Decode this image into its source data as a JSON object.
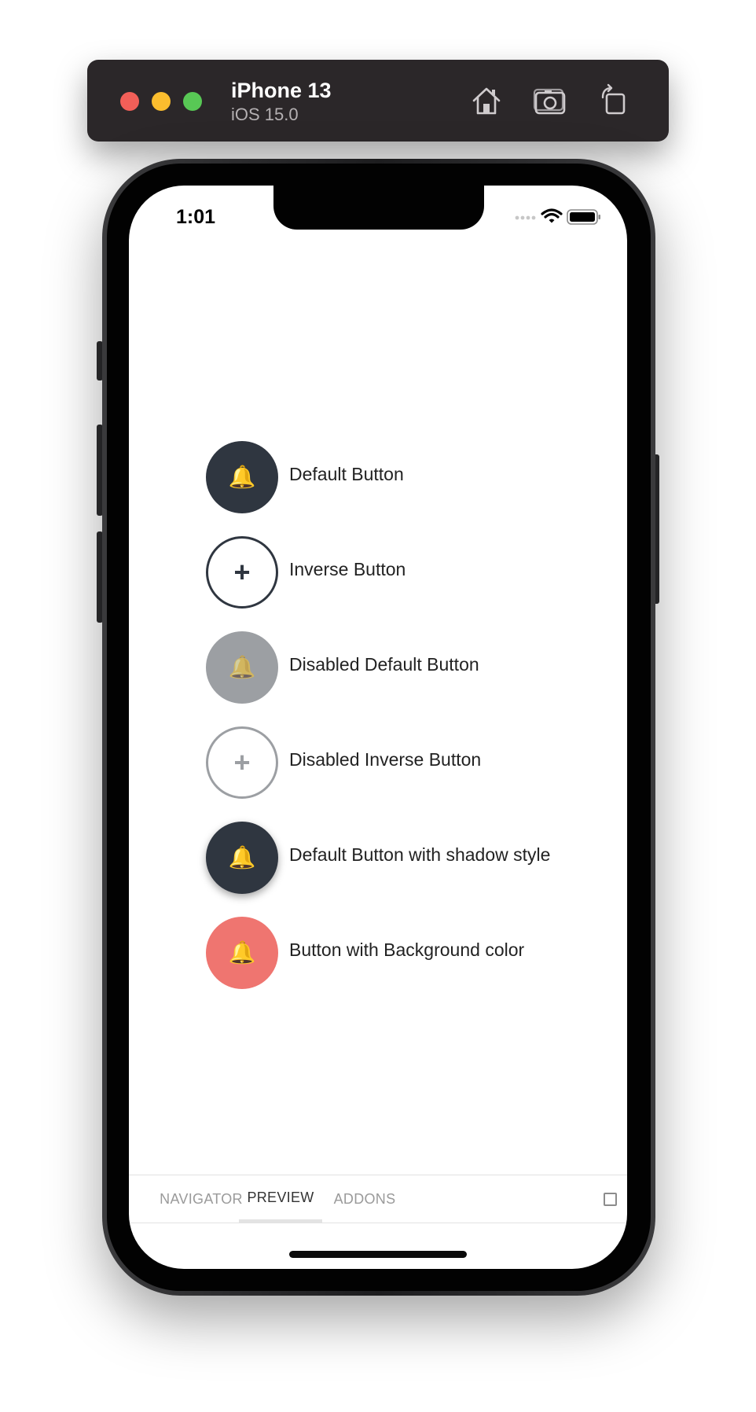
{
  "simulator": {
    "device_name": "iPhone 13",
    "os_version": "iOS 15.0",
    "toolbar_icons": [
      "home-icon",
      "screenshot-icon",
      "rotate-icon"
    ]
  },
  "status_bar": {
    "time": "1:01",
    "icons": [
      "cellular-icon",
      "wifi-icon",
      "battery-icon"
    ]
  },
  "buttons": [
    {
      "label": "Default Button",
      "icon": "bell-icon",
      "glyph": "🔔",
      "style": "default"
    },
    {
      "label": "Inverse Button",
      "icon": "plus-icon",
      "glyph": "+",
      "style": "inverse"
    },
    {
      "label": "Disabled Default Button",
      "icon": "bell-icon",
      "glyph": "🔔",
      "style": "disabled"
    },
    {
      "label": "Disabled Inverse Button",
      "icon": "plus-icon",
      "glyph": "+",
      "style": "disabled-inverse"
    },
    {
      "label": "Default Button with shadow style",
      "icon": "bell-icon",
      "glyph": "🔔",
      "style": "shadow"
    },
    {
      "label": "Button with Background color",
      "icon": "bell-icon",
      "glyph": "🔔",
      "style": "colored"
    }
  ],
  "tabs": [
    {
      "label": "NAVIGATOR",
      "active": false
    },
    {
      "label": "PREVIEW",
      "active": true
    },
    {
      "label": "ADDONS",
      "active": false
    }
  ],
  "colors": {
    "button_default": "#2f3640",
    "button_disabled": "#9c9fa3",
    "button_background_color": "#ef7570",
    "toolbar": "#2b2729"
  }
}
